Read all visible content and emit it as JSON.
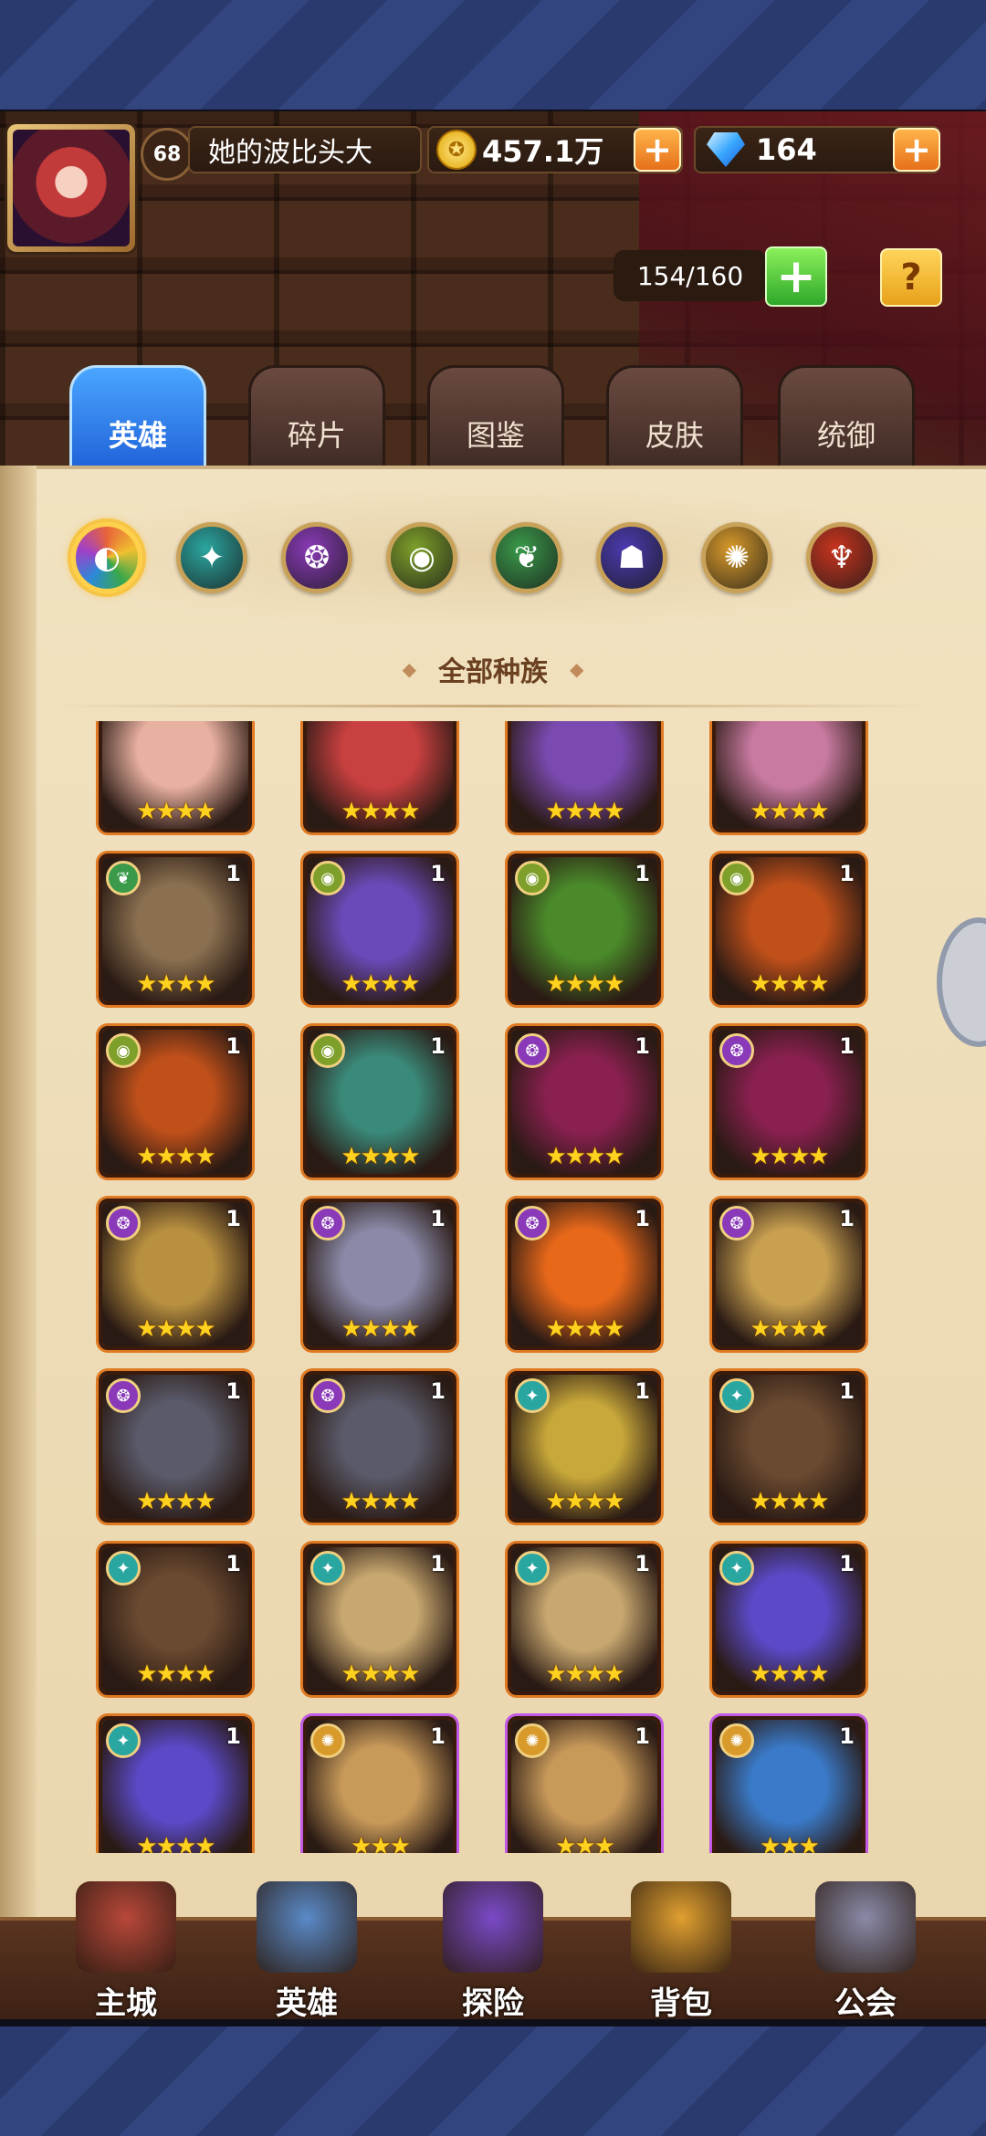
{
  "player": {
    "level": "68",
    "name": "她的波比头大"
  },
  "resources": {
    "gold": "457.1万",
    "gems": "164"
  },
  "capacity": "154/160",
  "help_label": "?",
  "tabs": [
    {
      "label": "英雄",
      "active": true
    },
    {
      "label": "碎片",
      "active": false
    },
    {
      "label": "图鉴",
      "active": false
    },
    {
      "label": "皮肤",
      "active": false
    },
    {
      "label": "统御",
      "active": false
    }
  ],
  "faction_filters": [
    {
      "name": "all-factions",
      "color": "#e8643a",
      "selected": true
    },
    {
      "name": "forest",
      "color": "#2aa6a0"
    },
    {
      "name": "shadow",
      "color": "#8a3ab8"
    },
    {
      "name": "fortress",
      "color": "#7ea02a"
    },
    {
      "name": "nature",
      "color": "#3a9a4a"
    },
    {
      "name": "abyss",
      "color": "#4a3ab0"
    },
    {
      "name": "light",
      "color": "#d89a2a"
    },
    {
      "name": "dark",
      "color": "#c8341e"
    }
  ],
  "filter_heading": "全部种族",
  "heroes": [
    {
      "faction": "none",
      "count": "",
      "stars": "★★★★",
      "frame": "orange",
      "tone": "#e8b0a0"
    },
    {
      "faction": "none",
      "count": "",
      "stars": "★★★★",
      "frame": "orange",
      "tone": "#c84040"
    },
    {
      "faction": "none",
      "count": "",
      "stars": "★★★★",
      "frame": "orange",
      "tone": "#7a4ab0"
    },
    {
      "faction": "none",
      "count": "",
      "stars": "★★★★",
      "frame": "orange",
      "tone": "#c87aa0"
    },
    {
      "faction": "nature",
      "count": "1",
      "stars": "★★★★",
      "frame": "orange",
      "tone": "#8a7050"
    },
    {
      "faction": "fortress",
      "count": "1",
      "stars": "★★★★",
      "frame": "orange",
      "tone": "#6a4ab8"
    },
    {
      "faction": "fortress",
      "count": "1",
      "stars": "★★★★",
      "frame": "orange",
      "tone": "#4a8a2a"
    },
    {
      "faction": "fortress",
      "count": "1",
      "stars": "★★★★",
      "frame": "orange",
      "tone": "#c0501a"
    },
    {
      "faction": "fortress",
      "count": "1",
      "stars": "★★★★",
      "frame": "orange",
      "tone": "#c0501a"
    },
    {
      "faction": "fortress",
      "count": "1",
      "stars": "★★★★",
      "frame": "orange",
      "tone": "#3a8a7a"
    },
    {
      "faction": "shadow",
      "count": "1",
      "stars": "★★★★",
      "frame": "orange",
      "tone": "#8a2050"
    },
    {
      "faction": "shadow",
      "count": "1",
      "stars": "★★★★",
      "frame": "orange",
      "tone": "#8a2050"
    },
    {
      "faction": "shadow",
      "count": "1",
      "stars": "★★★★",
      "frame": "orange",
      "tone": "#b89040"
    },
    {
      "faction": "shadow",
      "count": "1",
      "stars": "★★★★",
      "frame": "orange",
      "tone": "#8a8aa8"
    },
    {
      "faction": "shadow",
      "count": "1",
      "stars": "★★★★",
      "frame": "orange",
      "tone": "#e8681a"
    },
    {
      "faction": "shadow",
      "count": "1",
      "stars": "★★★★",
      "frame": "orange",
      "tone": "#c8a050"
    },
    {
      "faction": "shadow",
      "count": "1",
      "stars": "★★★★",
      "frame": "orange",
      "tone": "#5a5a6a"
    },
    {
      "faction": "shadow",
      "count": "1",
      "stars": "★★★★",
      "frame": "orange",
      "tone": "#5a5a6a"
    },
    {
      "faction": "forest",
      "count": "1",
      "stars": "★★★★",
      "frame": "orange",
      "tone": "#c8a83a"
    },
    {
      "faction": "forest",
      "count": "1",
      "stars": "★★★★",
      "frame": "orange",
      "tone": "#6a4a30"
    },
    {
      "faction": "forest",
      "count": "1",
      "stars": "★★★★",
      "frame": "orange",
      "tone": "#6a4a30"
    },
    {
      "faction": "forest",
      "count": "1",
      "stars": "★★★★",
      "frame": "orange",
      "tone": "#c8a870"
    },
    {
      "faction": "forest",
      "count": "1",
      "stars": "★★★★",
      "frame": "orange",
      "tone": "#c8a870"
    },
    {
      "faction": "forest",
      "count": "1",
      "stars": "★★★★",
      "frame": "orange",
      "tone": "#5a4ac8"
    },
    {
      "faction": "forest",
      "count": "1",
      "stars": "★★★★",
      "frame": "orange",
      "tone": "#5a4ac8"
    },
    {
      "faction": "light",
      "count": "1",
      "stars": "★★★",
      "frame": "purple",
      "tone": "#c89a5a"
    },
    {
      "faction": "light",
      "count": "1",
      "stars": "★★★",
      "frame": "purple",
      "tone": "#c89a5a"
    },
    {
      "faction": "light",
      "count": "1",
      "stars": "★★★",
      "frame": "purple",
      "tone": "#3a7ac8"
    }
  ],
  "faction_colors": {
    "forest": "#2aa6a0",
    "shadow": "#8a3ab8",
    "fortress": "#7ea02a",
    "nature": "#3a9a4a",
    "light": "#d89a2a",
    "none": "#000000"
  },
  "nav": [
    {
      "name": "nav-main-city",
      "label": "主城",
      "color": "#b8483a"
    },
    {
      "name": "nav-heroes",
      "label": "英雄",
      "color": "#5a8ac8"
    },
    {
      "name": "nav-explore",
      "label": "探险",
      "color": "#7a4ac8"
    },
    {
      "name": "nav-backpack",
      "label": "背包",
      "color": "#e0a030"
    },
    {
      "name": "nav-guild",
      "label": "公会",
      "color": "#8a8aa8"
    }
  ]
}
